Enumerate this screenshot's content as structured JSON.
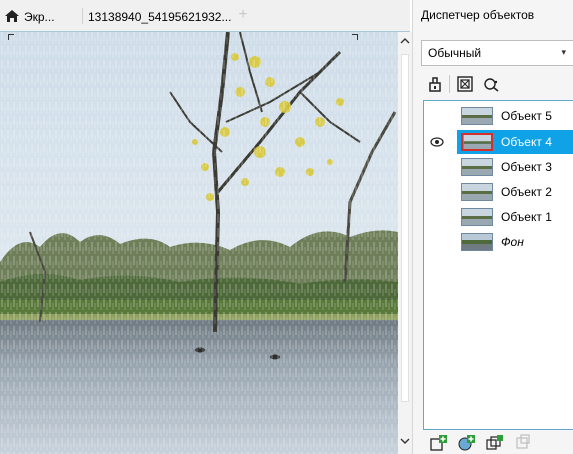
{
  "tabs": [
    {
      "label": "Экр...",
      "icon": "home-icon"
    },
    {
      "label": "13138940_54195621932...",
      "icon": null
    }
  ],
  "add_tab_symbol": "+",
  "docker": {
    "title": "Диспетчер объектов",
    "blend_mode": "Обычный",
    "objects": [
      {
        "label": "Объект 5",
        "visible": false,
        "selected": false,
        "italic": false
      },
      {
        "label": "Объект 4",
        "visible": true,
        "selected": true,
        "italic": false
      },
      {
        "label": "Объект 3",
        "visible": false,
        "selected": false,
        "italic": false
      },
      {
        "label": "Объект 2",
        "visible": false,
        "selected": false,
        "italic": false
      },
      {
        "label": "Объект 1",
        "visible": false,
        "selected": false,
        "italic": false
      },
      {
        "label": "Фон",
        "visible": false,
        "selected": false,
        "italic": true
      }
    ]
  },
  "colors": {
    "selection": "#0fa2e6",
    "panel_border": "#62a9c9",
    "green_plus": "#2f9e3a"
  }
}
